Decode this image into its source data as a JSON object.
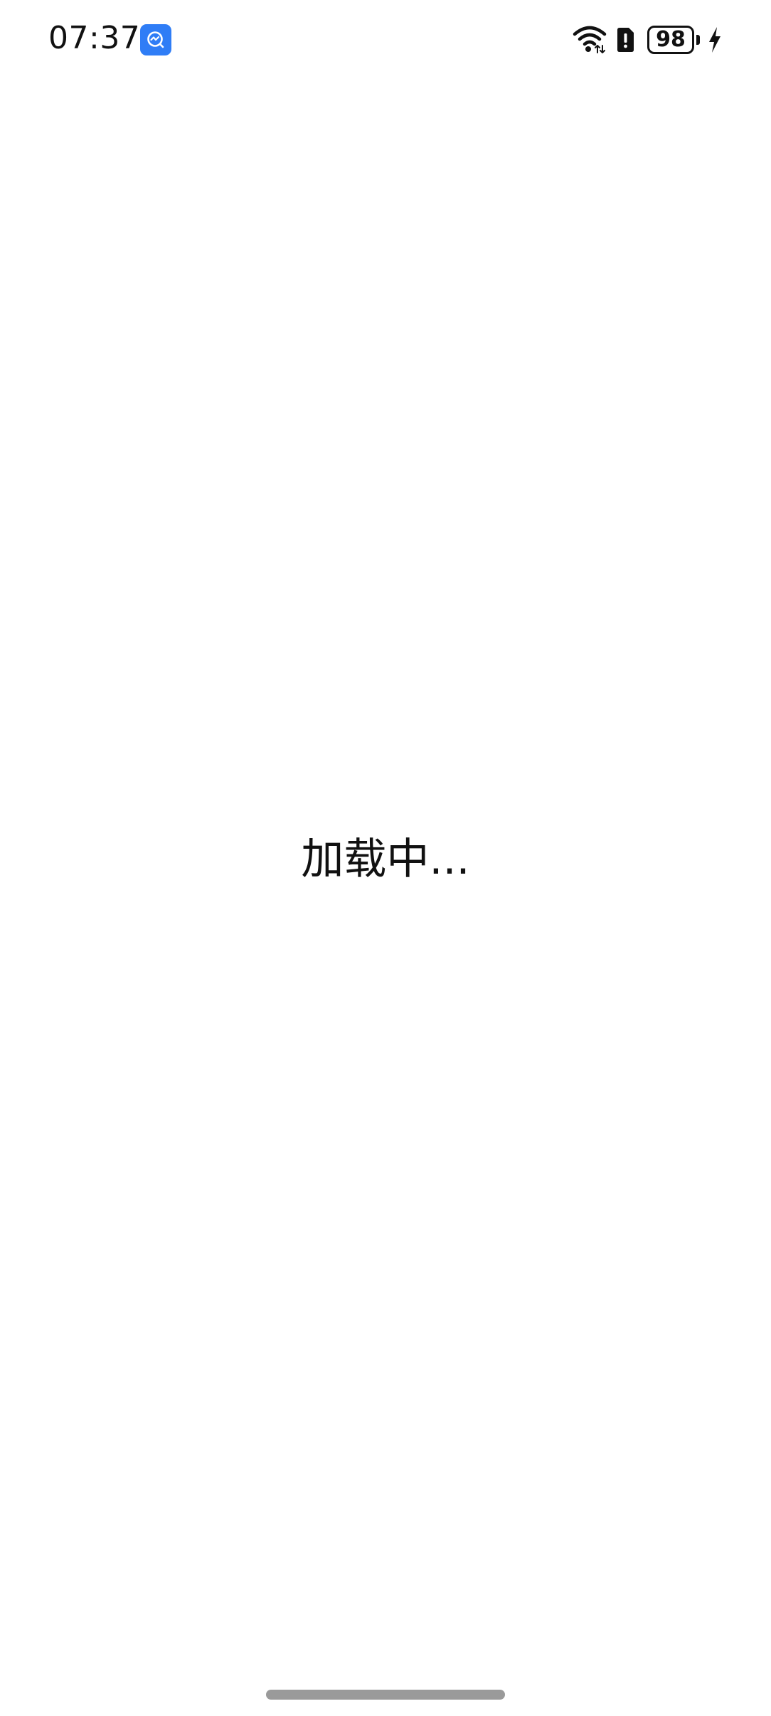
{
  "status_bar": {
    "time": "07:37",
    "battery_level": "98",
    "icons": [
      "app-notification-icon",
      "wifi-icon",
      "sim-alert-icon",
      "battery-icon",
      "charging-icon"
    ]
  },
  "main": {
    "loading_text": "加载中..."
  },
  "colors": {
    "accent": "#2f7df6",
    "text": "#111111",
    "background": "#ffffff",
    "home_indicator": "#9a9a9a"
  }
}
